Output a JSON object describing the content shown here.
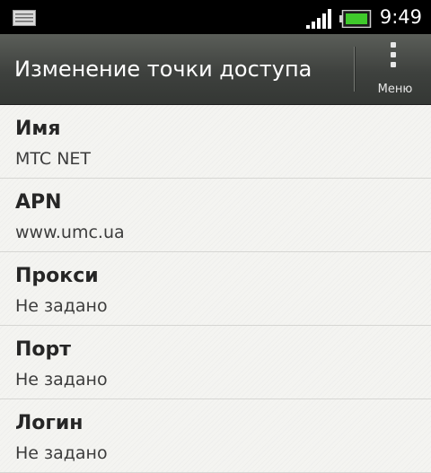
{
  "status_bar": {
    "time": "9:49",
    "notification_icon": "notes-icon",
    "signal_icon": "signal-icon",
    "battery_icon": "battery-icon",
    "battery_color": "#3fc92b"
  },
  "action_bar": {
    "title": "Изменение точки доступа",
    "menu_label": "Меню"
  },
  "fields": [
    {
      "label": "Имя",
      "value": "MTC NET"
    },
    {
      "label": "APN",
      "value": "www.umc.ua"
    },
    {
      "label": "Прокси",
      "value": "Не задано"
    },
    {
      "label": "Порт",
      "value": "Не задано"
    },
    {
      "label": "Логин",
      "value": "Не задано"
    }
  ]
}
